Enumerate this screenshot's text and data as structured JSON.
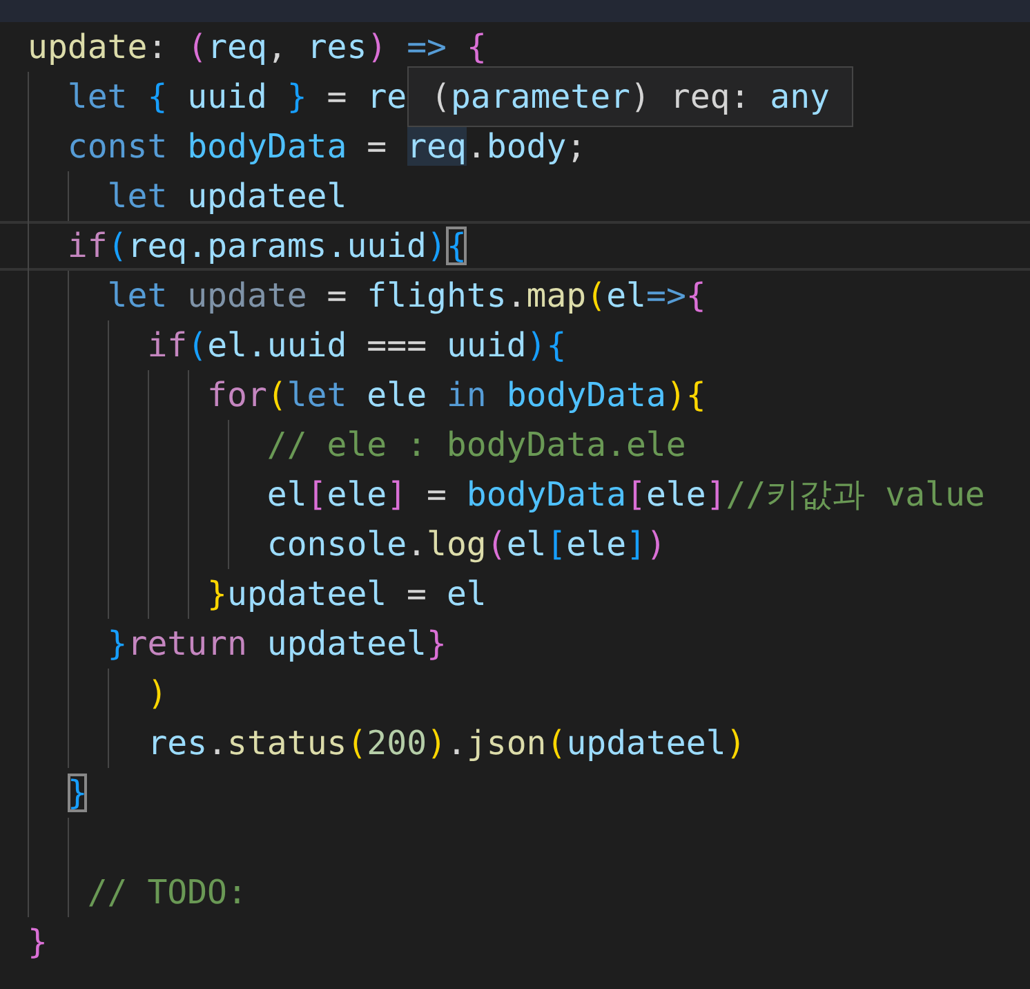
{
  "editor": {
    "lines": [
      {
        "current": false,
        "tokens": [
          {
            "text": "update",
            "kind": "function"
          },
          {
            "text": ": ",
            "kind": "plain"
          },
          {
            "text": "(",
            "kind": "bracket-pink"
          },
          {
            "text": "req",
            "kind": "variable"
          },
          {
            "text": ", ",
            "kind": "plain"
          },
          {
            "text": "res",
            "kind": "variable"
          },
          {
            "text": ")",
            "kind": "bracket-pink"
          },
          {
            "text": " =>",
            "kind": "storage"
          },
          {
            "text": " {",
            "kind": "bracket-pink"
          }
        ]
      },
      {
        "current": false,
        "tokens": [
          {
            "text": "  let",
            "kind": "storage"
          },
          {
            "text": " {",
            "kind": "bracket-blue"
          },
          {
            "text": " uuid ",
            "kind": "variable"
          },
          {
            "text": "}",
            "kind": "bracket-blue"
          },
          {
            "text": " = ",
            "kind": "plain"
          },
          {
            "text": "re",
            "kind": "variable"
          }
        ]
      },
      {
        "current": false,
        "tokens": [
          {
            "text": "  const",
            "kind": "storage"
          },
          {
            "text": " bodyData",
            "kind": "constant"
          },
          {
            "text": " = ",
            "kind": "plain"
          },
          {
            "text": "req",
            "kind": "variable",
            "highlighted": true
          },
          {
            "text": ".",
            "kind": "plain"
          },
          {
            "text": "body",
            "kind": "variable"
          },
          {
            "text": ";",
            "kind": "plain"
          }
        ]
      },
      {
        "current": false,
        "tokens": [
          {
            "text": "    let",
            "kind": "storage"
          },
          {
            "text": " updateel",
            "kind": "variable"
          }
        ]
      },
      {
        "current": true,
        "tokens": [
          {
            "text": "  if",
            "kind": "keyword"
          },
          {
            "text": "(",
            "kind": "bracket-blue"
          },
          {
            "text": "req.params.uuid",
            "kind": "variable"
          },
          {
            "text": ")",
            "kind": "bracket-blue"
          },
          {
            "text": "{",
            "kind": "bracket-blue",
            "matched": true
          }
        ]
      },
      {
        "current": false,
        "tokens": [
          {
            "text": "    let",
            "kind": "storage"
          },
          {
            "text": " update",
            "kind": "unused"
          },
          {
            "text": " = ",
            "kind": "plain"
          },
          {
            "text": "flights",
            "kind": "variable"
          },
          {
            "text": ".",
            "kind": "plain"
          },
          {
            "text": "map",
            "kind": "function"
          },
          {
            "text": "(",
            "kind": "bracket-yellow"
          },
          {
            "text": "el",
            "kind": "variable"
          },
          {
            "text": "=>",
            "kind": "storage"
          },
          {
            "text": "{",
            "kind": "bracket-pink"
          }
        ]
      },
      {
        "current": false,
        "tokens": [
          {
            "text": "      if",
            "kind": "keyword"
          },
          {
            "text": "(",
            "kind": "bracket-blue"
          },
          {
            "text": "el.uuid",
            "kind": "variable"
          },
          {
            "text": " === ",
            "kind": "plain"
          },
          {
            "text": "uuid",
            "kind": "variable"
          },
          {
            "text": ")",
            "kind": "bracket-blue"
          },
          {
            "text": "{",
            "kind": "bracket-blue"
          }
        ]
      },
      {
        "current": false,
        "tokens": [
          {
            "text": "         for",
            "kind": "keyword"
          },
          {
            "text": "(",
            "kind": "bracket-yellow"
          },
          {
            "text": "let",
            "kind": "storage"
          },
          {
            "text": " ele",
            "kind": "variable"
          },
          {
            "text": " in",
            "kind": "storage"
          },
          {
            "text": " bodyData",
            "kind": "constant"
          },
          {
            "text": ")",
            "kind": "bracket-yellow"
          },
          {
            "text": "{",
            "kind": "bracket-yellow"
          }
        ]
      },
      {
        "current": false,
        "tokens": [
          {
            "text": "            // ele : bodyData.ele",
            "kind": "comment"
          }
        ]
      },
      {
        "current": false,
        "tokens": [
          {
            "text": "            el",
            "kind": "variable"
          },
          {
            "text": "[",
            "kind": "bracket-pink"
          },
          {
            "text": "ele",
            "kind": "variable"
          },
          {
            "text": "]",
            "kind": "bracket-pink"
          },
          {
            "text": " = ",
            "kind": "plain"
          },
          {
            "text": "bodyData",
            "kind": "constant"
          },
          {
            "text": "[",
            "kind": "bracket-pink"
          },
          {
            "text": "ele",
            "kind": "variable"
          },
          {
            "text": "]",
            "kind": "bracket-pink"
          },
          {
            "text": "//키값과 value",
            "kind": "comment"
          }
        ]
      },
      {
        "current": false,
        "tokens": [
          {
            "text": "            console",
            "kind": "variable"
          },
          {
            "text": ".",
            "kind": "plain"
          },
          {
            "text": "log",
            "kind": "function"
          },
          {
            "text": "(",
            "kind": "bracket-pink"
          },
          {
            "text": "el",
            "kind": "variable"
          },
          {
            "text": "[",
            "kind": "bracket-blue"
          },
          {
            "text": "ele",
            "kind": "variable"
          },
          {
            "text": "]",
            "kind": "bracket-blue"
          },
          {
            "text": ")",
            "kind": "bracket-pink"
          }
        ]
      },
      {
        "current": false,
        "tokens": [
          {
            "text": "         }",
            "kind": "bracket-yellow"
          },
          {
            "text": "updateel",
            "kind": "variable"
          },
          {
            "text": " = ",
            "kind": "plain"
          },
          {
            "text": "el",
            "kind": "variable"
          }
        ]
      },
      {
        "current": false,
        "tokens": [
          {
            "text": "    }",
            "kind": "bracket-blue"
          },
          {
            "text": "return",
            "kind": "keyword"
          },
          {
            "text": " updateel",
            "kind": "variable"
          },
          {
            "text": "}",
            "kind": "bracket-pink"
          }
        ]
      },
      {
        "current": false,
        "tokens": [
          {
            "text": "      )",
            "kind": "bracket-yellow"
          }
        ]
      },
      {
        "current": false,
        "tokens": [
          {
            "text": "      res",
            "kind": "variable"
          },
          {
            "text": ".",
            "kind": "plain"
          },
          {
            "text": "status",
            "kind": "function"
          },
          {
            "text": "(",
            "kind": "bracket-yellow"
          },
          {
            "text": "200",
            "kind": "number"
          },
          {
            "text": ")",
            "kind": "bracket-yellow"
          },
          {
            "text": ".",
            "kind": "plain"
          },
          {
            "text": "json",
            "kind": "function"
          },
          {
            "text": "(",
            "kind": "bracket-yellow"
          },
          {
            "text": "updateel",
            "kind": "variable"
          },
          {
            "text": ")",
            "kind": "bracket-yellow"
          }
        ]
      },
      {
        "current": false,
        "tokens": [
          {
            "text": "  }",
            "kind": "bracket-blue",
            "matched": true
          }
        ]
      },
      {
        "current": false
      },
      {
        "current": false,
        "tokens": [
          {
            "text": "   // TODO:",
            "kind": "comment"
          }
        ]
      },
      {
        "current": false,
        "tokens": [
          {
            "text": "}",
            "kind": "bracket-pink"
          }
        ]
      }
    ]
  },
  "hover_tooltip": {
    "tokens": [
      {
        "text": "(",
        "kind": "plain"
      },
      {
        "text": "parameter",
        "kind": "storage-light"
      },
      {
        "text": ") ",
        "kind": "plain"
      },
      {
        "text": "req: ",
        "kind": "plain"
      },
      {
        "text": "any",
        "kind": "storage-light"
      }
    ]
  }
}
